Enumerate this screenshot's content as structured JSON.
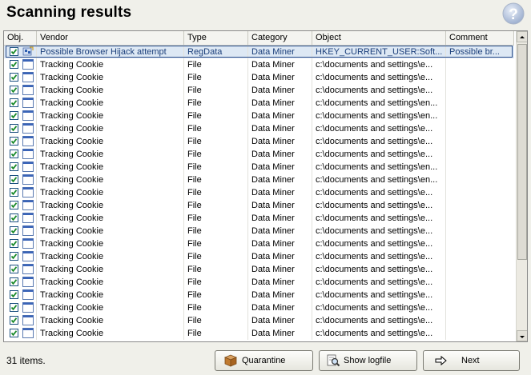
{
  "title": "Scanning results",
  "columns": [
    "Obj.",
    "Vendor",
    "Type",
    "Category",
    "Object",
    "Comment"
  ],
  "rows": [
    {
      "vendor": "Possible Browser Hijack attempt",
      "type": "RegData",
      "category": "Data Miner",
      "object": "HKEY_CURRENT_USER:Soft...",
      "comment": "Possible br...",
      "icon": "registry-icon",
      "checked": true,
      "selected": true
    },
    {
      "vendor": "Tracking Cookie",
      "type": "File",
      "category": "Data Miner",
      "object": "c:\\documents and settings\\e...",
      "comment": "",
      "icon": "file-icon",
      "checked": true
    },
    {
      "vendor": "Tracking Cookie",
      "type": "File",
      "category": "Data Miner",
      "object": "c:\\documents and settings\\e...",
      "comment": "",
      "icon": "file-icon",
      "checked": true
    },
    {
      "vendor": "Tracking Cookie",
      "type": "File",
      "category": "Data Miner",
      "object": "c:\\documents and settings\\e...",
      "comment": "",
      "icon": "file-icon",
      "checked": true
    },
    {
      "vendor": "Tracking Cookie",
      "type": "File",
      "category": "Data Miner",
      "object": "c:\\documents and settings\\en...",
      "comment": "",
      "icon": "file-icon",
      "checked": true
    },
    {
      "vendor": "Tracking Cookie",
      "type": "File",
      "category": "Data Miner",
      "object": "c:\\documents and settings\\en...",
      "comment": "",
      "icon": "file-icon",
      "checked": true
    },
    {
      "vendor": "Tracking Cookie",
      "type": "File",
      "category": "Data Miner",
      "object": "c:\\documents and settings\\e...",
      "comment": "",
      "icon": "file-icon",
      "checked": true
    },
    {
      "vendor": "Tracking Cookie",
      "type": "File",
      "category": "Data Miner",
      "object": "c:\\documents and settings\\e...",
      "comment": "",
      "icon": "file-icon",
      "checked": true
    },
    {
      "vendor": "Tracking Cookie",
      "type": "File",
      "category": "Data Miner",
      "object": "c:\\documents and settings\\e...",
      "comment": "",
      "icon": "file-icon",
      "checked": true
    },
    {
      "vendor": "Tracking Cookie",
      "type": "File",
      "category": "Data Miner",
      "object": "c:\\documents and settings\\en...",
      "comment": "",
      "icon": "file-icon",
      "checked": true
    },
    {
      "vendor": "Tracking Cookie",
      "type": "File",
      "category": "Data Miner",
      "object": "c:\\documents and settings\\en...",
      "comment": "",
      "icon": "file-icon",
      "checked": true
    },
    {
      "vendor": "Tracking Cookie",
      "type": "File",
      "category": "Data Miner",
      "object": "c:\\documents and settings\\e...",
      "comment": "",
      "icon": "file-icon",
      "checked": true
    },
    {
      "vendor": "Tracking Cookie",
      "type": "File",
      "category": "Data Miner",
      "object": "c:\\documents and settings\\e...",
      "comment": "",
      "icon": "file-icon",
      "checked": true
    },
    {
      "vendor": "Tracking Cookie",
      "type": "File",
      "category": "Data Miner",
      "object": "c:\\documents and settings\\e...",
      "comment": "",
      "icon": "file-icon",
      "checked": true
    },
    {
      "vendor": "Tracking Cookie",
      "type": "File",
      "category": "Data Miner",
      "object": "c:\\documents and settings\\e...",
      "comment": "",
      "icon": "file-icon",
      "checked": true
    },
    {
      "vendor": "Tracking Cookie",
      "type": "File",
      "category": "Data Miner",
      "object": "c:\\documents and settings\\e...",
      "comment": "",
      "icon": "file-icon",
      "checked": true
    },
    {
      "vendor": "Tracking Cookie",
      "type": "File",
      "category": "Data Miner",
      "object": "c:\\documents and settings\\e...",
      "comment": "",
      "icon": "file-icon",
      "checked": true
    },
    {
      "vendor": "Tracking Cookie",
      "type": "File",
      "category": "Data Miner",
      "object": "c:\\documents and settings\\e...",
      "comment": "",
      "icon": "file-icon",
      "checked": true
    },
    {
      "vendor": "Tracking Cookie",
      "type": "File",
      "category": "Data Miner",
      "object": "c:\\documents and settings\\e...",
      "comment": "",
      "icon": "file-icon",
      "checked": true
    },
    {
      "vendor": "Tracking Cookie",
      "type": "File",
      "category": "Data Miner",
      "object": "c:\\documents and settings\\e...",
      "comment": "",
      "icon": "file-icon",
      "checked": true
    },
    {
      "vendor": "Tracking Cookie",
      "type": "File",
      "category": "Data Miner",
      "object": "c:\\documents and settings\\e...",
      "comment": "",
      "icon": "file-icon",
      "checked": true
    },
    {
      "vendor": "Tracking Cookie",
      "type": "File",
      "category": "Data Miner",
      "object": "c:\\documents and settings\\e...",
      "comment": "",
      "icon": "file-icon",
      "checked": true
    },
    {
      "vendor": "Tracking Cookie",
      "type": "File",
      "category": "Data Miner",
      "object": "c:\\documents and settings\\e...",
      "comment": "",
      "icon": "file-icon",
      "checked": true
    }
  ],
  "status": "31 items.",
  "buttons": {
    "quarantine": "Quarantine",
    "show_logfile": "Show logfile",
    "next": "Next"
  },
  "icons": {
    "help": "help-icon",
    "quarantine": "box-icon",
    "show_logfile": "magnifier-icon",
    "next": "arrow-right-icon"
  },
  "colors": {
    "selection": "#dde8f4",
    "checkbox_border": "#1c5180",
    "check_mark": "#1a8a2a",
    "help_icon": "#8aa0c4"
  }
}
